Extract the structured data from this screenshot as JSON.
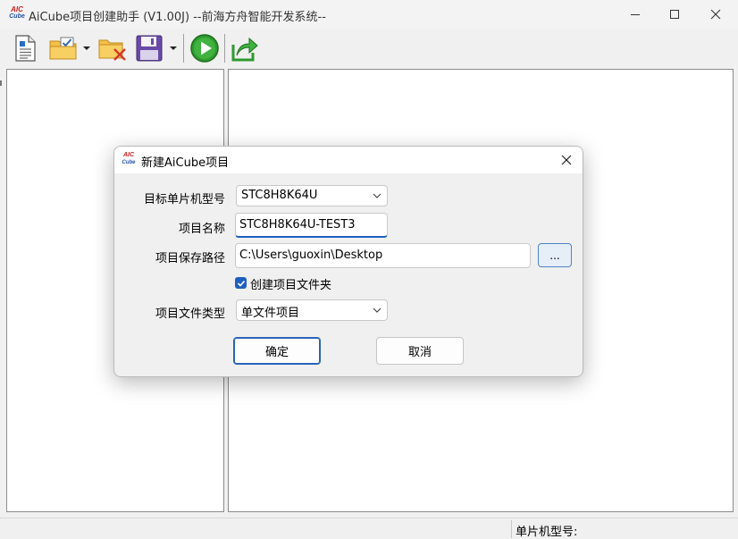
{
  "window": {
    "title": "AiCube项目创建助手 (V1.00J) --前海方舟智能开发系统--",
    "logo_top": "AIC",
    "logo_bottom": "Cube"
  },
  "toolbar": {
    "items": [
      {
        "name": "new-document-icon"
      },
      {
        "name": "open-folder-check-icon",
        "dropdown": true
      },
      {
        "name": "close-folder-icon"
      },
      {
        "name": "save-icon",
        "dropdown": true
      },
      {
        "name": "play-run-icon"
      },
      {
        "name": "export-share-icon"
      }
    ]
  },
  "status": {
    "mcu_model_label": "单片机型号:"
  },
  "dialog": {
    "title": "新建AiCube项目",
    "fields": {
      "mcu_label": "目标单片机型号",
      "mcu_value": "STC8H8K64U",
      "name_label": "项目名称",
      "name_value": "STC8H8K64U-TEST3",
      "path_label": "项目保存路径",
      "path_value": "C:\\Users\\guoxin\\Desktop",
      "browse_label": "...",
      "create_folder_label": "创建项目文件夹",
      "create_folder_checked": true,
      "filetype_label": "项目文件类型",
      "filetype_value": "单文件项目"
    },
    "ok_label": "确定",
    "cancel_label": "取消"
  },
  "colors": {
    "accent": "#1f5fbf",
    "logo_red": "#c81e1e",
    "logo_blue": "#1f4fa8"
  }
}
